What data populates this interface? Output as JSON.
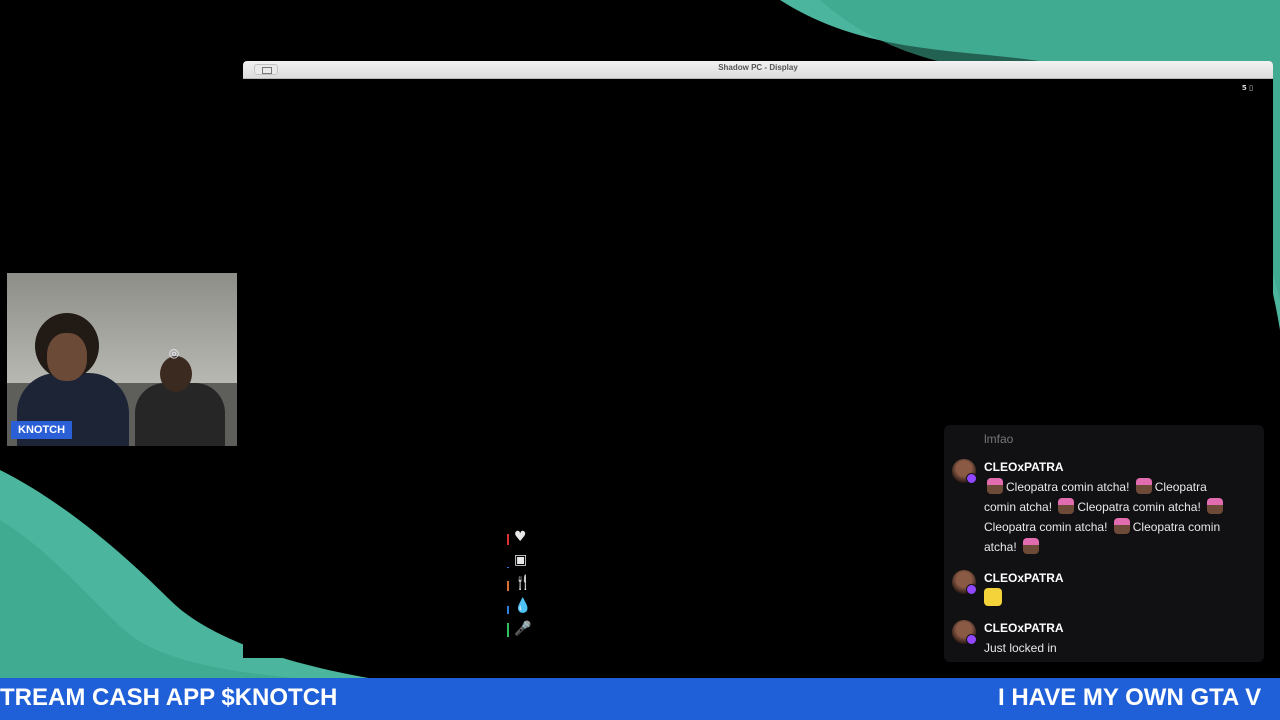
{
  "window": {
    "title": "Shadow PC - Display",
    "status": "5 ▯"
  },
  "hud": [
    {
      "name": "health",
      "icon": "heart-icon",
      "glyph": "♥",
      "color": "#d93030",
      "level": 0.7
    },
    {
      "name": "armor",
      "icon": "armor-vest-icon",
      "glyph": "▣",
      "color": "#3070d9",
      "level": 0.0
    },
    {
      "name": "hunger",
      "icon": "fork-knife-icon",
      "glyph": "🍴",
      "color": "#d97030",
      "level": 0.6
    },
    {
      "name": "thirst",
      "icon": "water-drop-icon",
      "glyph": "💧",
      "color": "#3080e0",
      "level": 0.5
    },
    {
      "name": "voice",
      "icon": "microphone-icon",
      "glyph": "🎤",
      "color": "#30c060",
      "level": 0.9
    }
  ],
  "webcam": {
    "label": "KNOTCH"
  },
  "chat": {
    "faded_message": "lmfao",
    "messages": [
      {
        "user": "CLEOxPATRA",
        "line1": "Cleopatra comin atcha!",
        "line2": "Cleopatra",
        "line3": "comin atcha!",
        "line4": "Cleopatra comin atcha!",
        "line5": "Cleopatra comin atcha!",
        "line6": "Cleopatra comin",
        "line7": "atcha!"
      },
      {
        "user": "CLEOxPATRA",
        "emote": "pikachu"
      },
      {
        "user": "CLEOxPATRA",
        "text": "Just locked in"
      }
    ]
  },
  "ticker": {
    "left": "TREAM CASH APP $KNOTCH",
    "right": "I HAVE MY OWN GTA V"
  }
}
